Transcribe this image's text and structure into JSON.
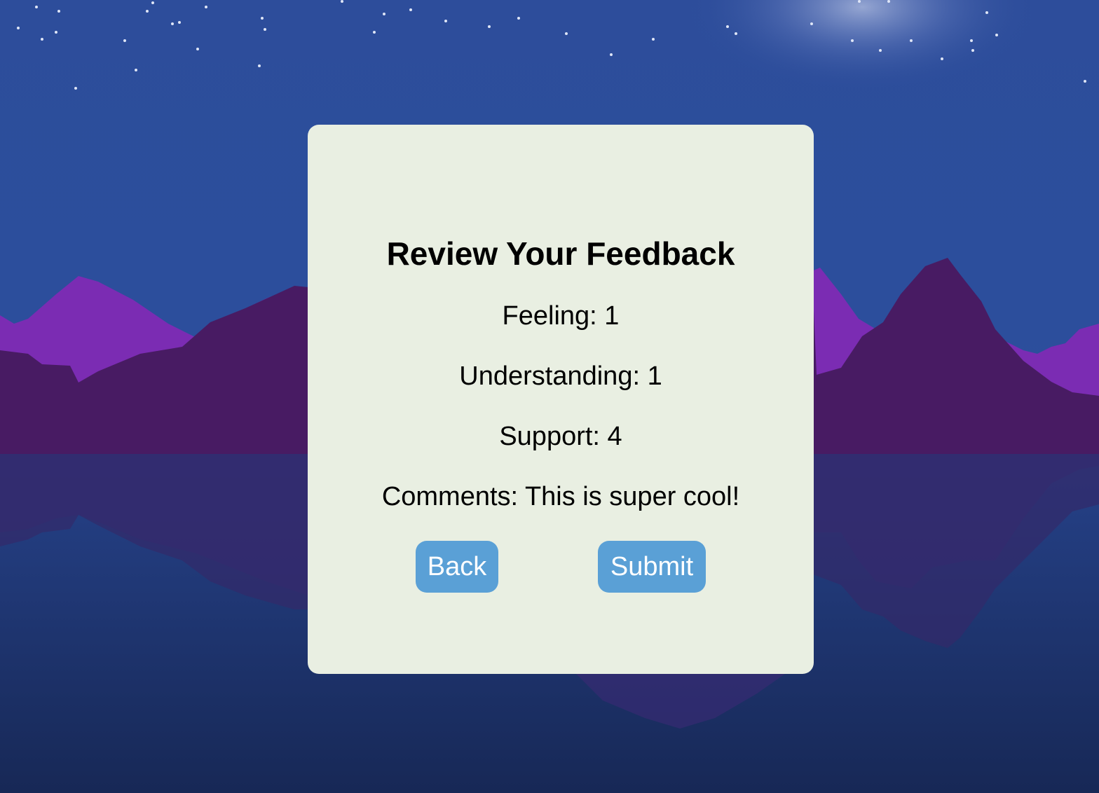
{
  "review": {
    "title": "Review Your Feedback",
    "feeling": "Feeling: 1",
    "understanding": "Understanding: 1",
    "support": "Support: 4",
    "comments": "Comments: This is super cool!"
  },
  "actions": {
    "back_label": "Back",
    "submit_label": "Submit"
  },
  "colors": {
    "sky_top": "#2d4f9e",
    "sky_bottom": "#2a4e9a",
    "mountain_back": "#7b2cb3",
    "mountain_front": "#481b63",
    "water_top": "#253f86",
    "water_bottom": "#182a58",
    "card_background": "#e9efe2",
    "button_background": "#5aa0d6",
    "button_text": "#ffffff"
  },
  "icons": {
    "background": "night-mountain-lake-scene"
  }
}
